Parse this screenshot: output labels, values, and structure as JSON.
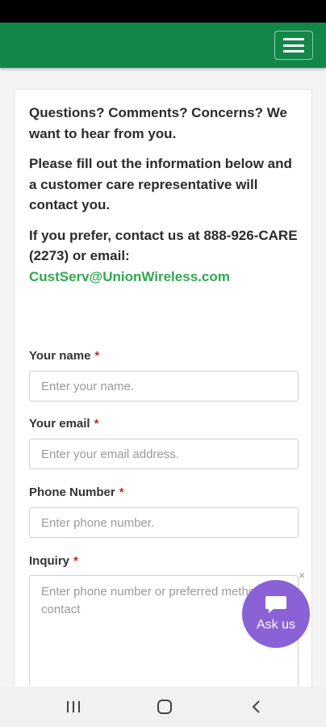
{
  "header": {
    "menu_icon": "hamburger-menu-icon",
    "brand_color": "#13874a"
  },
  "intro": {
    "line1": "Questions? Comments? Concerns? We want to hear from you.",
    "line2": "Please fill out the information below and a customer care representative will contact you.",
    "line3_prefix": "If you prefer, contact us at 888-926-CARE (2273) or email:",
    "email": "CustServ@UnionWireless.com",
    "email_color": "#2fa84f"
  },
  "form": {
    "required_marker": "*",
    "name": {
      "label": "Your name",
      "placeholder": "Enter your name."
    },
    "email": {
      "label": "Your email",
      "placeholder": "Enter your email address."
    },
    "phone": {
      "label": "Phone Number",
      "placeholder": "Enter phone number."
    },
    "inquiry": {
      "label": "Inquiry",
      "placeholder": "Enter phone number or preferred method of contact"
    }
  },
  "chat": {
    "label": "Ask us",
    "close": "×",
    "color": "#8a62d6"
  },
  "navigation_bar": {
    "recents_icon": "recent-apps-icon",
    "home_icon": "home-icon",
    "back_icon": "back-icon"
  }
}
